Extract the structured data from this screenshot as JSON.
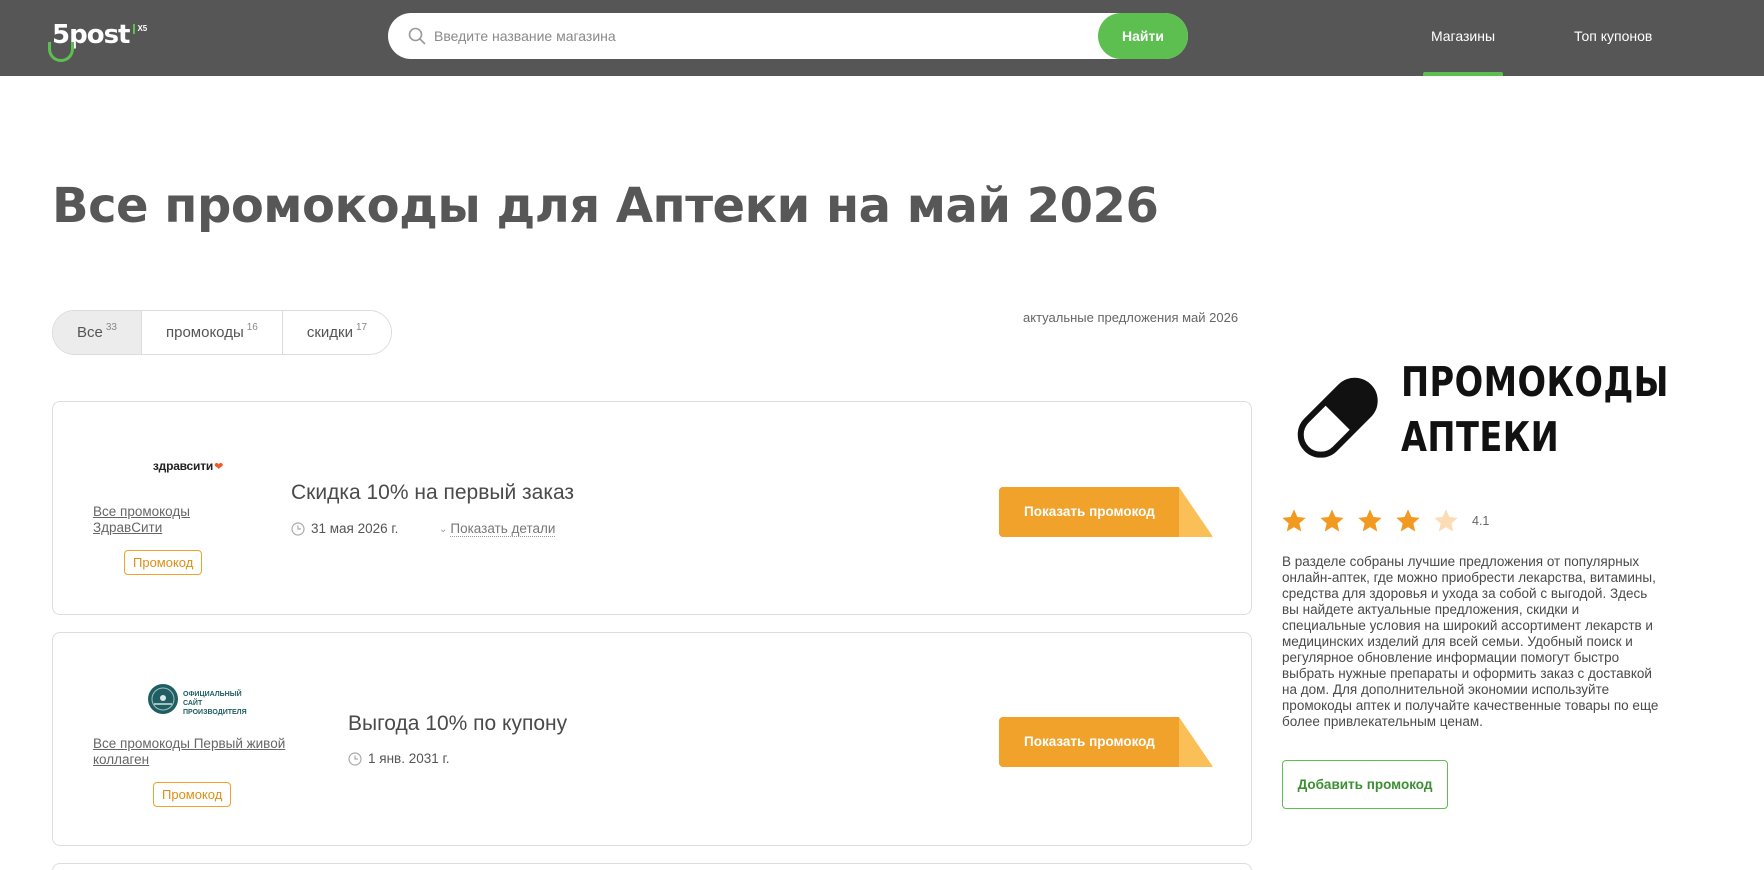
{
  "header": {
    "logo_text": "5post",
    "logo_badge": "X5",
    "search_placeholder": "Введите название магазина",
    "search_button": "Найти",
    "nav": [
      {
        "label": "Магазины",
        "active": true
      },
      {
        "label": "Топ купонов",
        "active": false
      }
    ]
  },
  "page_title": "Все промокоды для Аптеки на май 2026",
  "filters": [
    {
      "label": "Все",
      "count": "33",
      "active": true
    },
    {
      "label": "промокоды",
      "count": "16",
      "active": false
    },
    {
      "label": "скидки",
      "count": "17",
      "active": false
    }
  ],
  "actual_note": "актуальные предложения май 2026",
  "coupons": [
    {
      "store_logo_text": "здравсити",
      "store_link": "Все промокоды ЗдравСити",
      "badge": "Промокод",
      "title": "Скидка 10% на первый заказ",
      "date": "31 мая 2026 г.",
      "details_label": "Показать детали",
      "button": "Показать промокод"
    },
    {
      "store_logo_text": "ОФИЦИАЛЬНЫЙ САЙТ ПРОИЗВОДИТЕЛЯ",
      "store_link": "Все промокоды Первый живой коллаген",
      "badge": "Промокод",
      "title": "Выгода 10% по купону",
      "date": "1 янв. 2031 г.",
      "button": "Показать промокод"
    }
  ],
  "sidebar": {
    "logo_line1": "ПРОМОКОДЫ",
    "logo_line2": "АПТЕКИ",
    "rating_value": "4.1",
    "rating_stars": 4.1,
    "description": "В разделе собраны лучшие предложения от популярных онлайн-аптек, где можно приобрести лекарства, витамины, средства для здоровья и ухода за собой с выгодой. Здесь вы найдете актуальные предложения, скидки и специальные условия на широкий ассортимент лекарств и медицинских изделий для всей семьи. Удобный поиск и регулярное обновление информации помогут быстро выбрать нужные препараты и оформить заказ с доставкой на дом. Для дополнительной экономии используйте промокоды аптек и получайте качественные товары по еще более привлекательным ценам.",
    "add_button": "Добавить промокод"
  },
  "colors": {
    "header_bg": "#565656",
    "accent_green": "#5cbf4f",
    "accent_orange": "#f0a22b",
    "star": "#f29a1f"
  }
}
